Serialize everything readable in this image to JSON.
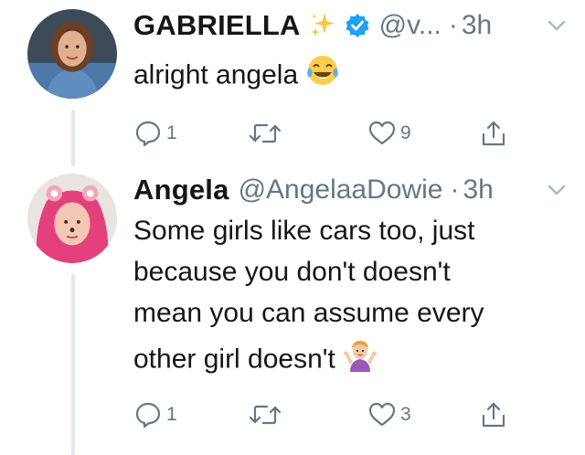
{
  "tweets": [
    {
      "name": "GABRIELLA",
      "handle": "@v...",
      "dot": "·",
      "time": "3h",
      "text": "alright angela",
      "reply_count": "1",
      "retweet_count": "",
      "like_count": "9"
    },
    {
      "name": "Angela",
      "handle": "@AngelaaDowie",
      "dot": "·",
      "time": "3h",
      "text_lines": [
        "Some girls like cars too, just",
        "because you don't doesn't",
        "mean you can assume every",
        "other girl doesn't"
      ],
      "reply_count": "1",
      "retweet_count": "",
      "like_count": "3"
    }
  ],
  "colors": {
    "text": "#14171a",
    "muted": "#657786",
    "verified": "#1da1f2",
    "thread_line": "#e1e8ed"
  },
  "icons": [
    "sparkles-icon",
    "verified-badge-icon",
    "chevron-down-icon",
    "reply-icon",
    "retweet-icon",
    "like-icon",
    "share-icon",
    "tears-of-joy-emoji",
    "shrug-emoji"
  ]
}
